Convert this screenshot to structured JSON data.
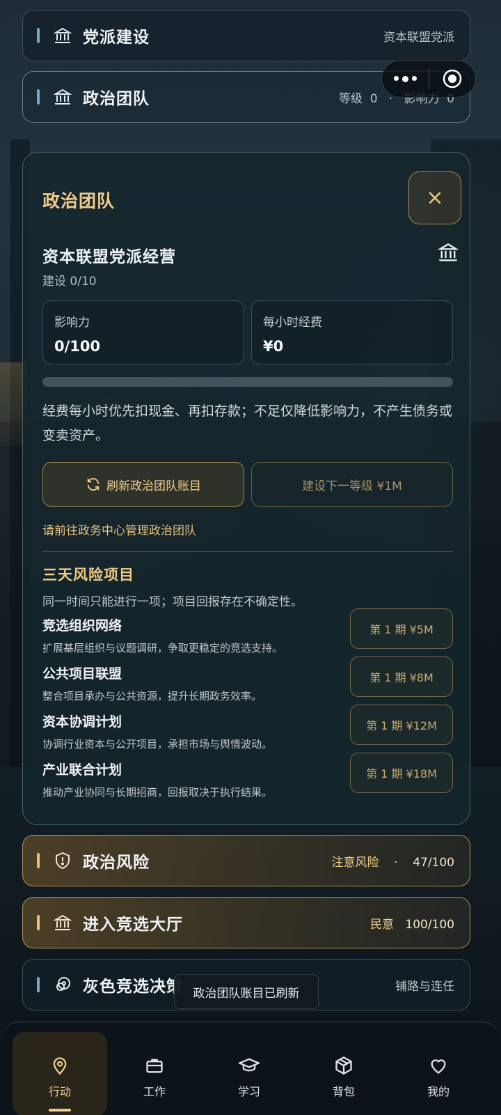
{
  "rows": {
    "party": {
      "title": "党派建设",
      "meta": "资本联盟党派",
      "icon": "bank-icon"
    },
    "team": {
      "title": "政治团队",
      "level_label": "等级",
      "level": "0",
      "sep": "·",
      "influence_label": "影响力",
      "influence": "0",
      "icon": "bank-icon"
    },
    "risk": {
      "title": "政治风险",
      "status": "注意风险",
      "sep": "·",
      "value": "47/100",
      "icon": "shield-alert-icon"
    },
    "election": {
      "title": "进入竞选大厅",
      "label": "民意",
      "value": "100/100",
      "icon": "bank-icon"
    },
    "gray": {
      "title": "灰色竞选决策",
      "meta": "铺路与连任",
      "icon": "link-icon"
    }
  },
  "panel": {
    "title": "政治团队",
    "org_title": "资本联盟党派经营",
    "org_sub": "建设 0/10",
    "stats": [
      {
        "label": "影响力",
        "value": "0/100"
      },
      {
        "label": "每小时经费",
        "value": "¥0"
      }
    ],
    "progress": 0,
    "note": "经费每小时优先扣现金、再扣存款；不足仅降低影响力，不产生债务或变卖资产。",
    "refresh_label": "刷新政治团队账目",
    "build_label": "建设下一等级 ¥1M",
    "hint": "请前往政务中心管理政治团队",
    "section_title": "三天风险项目",
    "section_sub": "同一时间只能进行一项；项目回报存在不确定性。",
    "projects": [
      {
        "name": "竞选组织网络",
        "desc": "扩展基层组织与议题调研，争取更稳定的竞选支持。",
        "action": "第 1 期 ¥5M"
      },
      {
        "name": "公共项目联盟",
        "desc": "整合项目承办与公共资源，提升长期政务效率。",
        "action": "第 1 期 ¥8M"
      },
      {
        "name": "资本协调计划",
        "desc": "协调行业资本与公开项目，承担市场与舆情波动。",
        "action": "第 1 期 ¥12M"
      },
      {
        "name": "产业联合计划",
        "desc": "推动产业协同与长期招商，回报取决于执行结果。",
        "action": "第 1 期 ¥18M"
      }
    ]
  },
  "toast": "政治团队账目已刷新",
  "tabs": [
    {
      "label": "行动",
      "icon": "location-pin-icon",
      "active": true
    },
    {
      "label": "工作",
      "icon": "briefcase-icon"
    },
    {
      "label": "学习",
      "icon": "graduation-cap-icon"
    },
    {
      "label": "背包",
      "icon": "box-icon"
    },
    {
      "label": "我的",
      "icon": "heart-icon"
    }
  ],
  "colors": {
    "gold": "#f2cd8a",
    "accent_blue": "#7aa7c7",
    "panel_bg": "#14262c"
  }
}
